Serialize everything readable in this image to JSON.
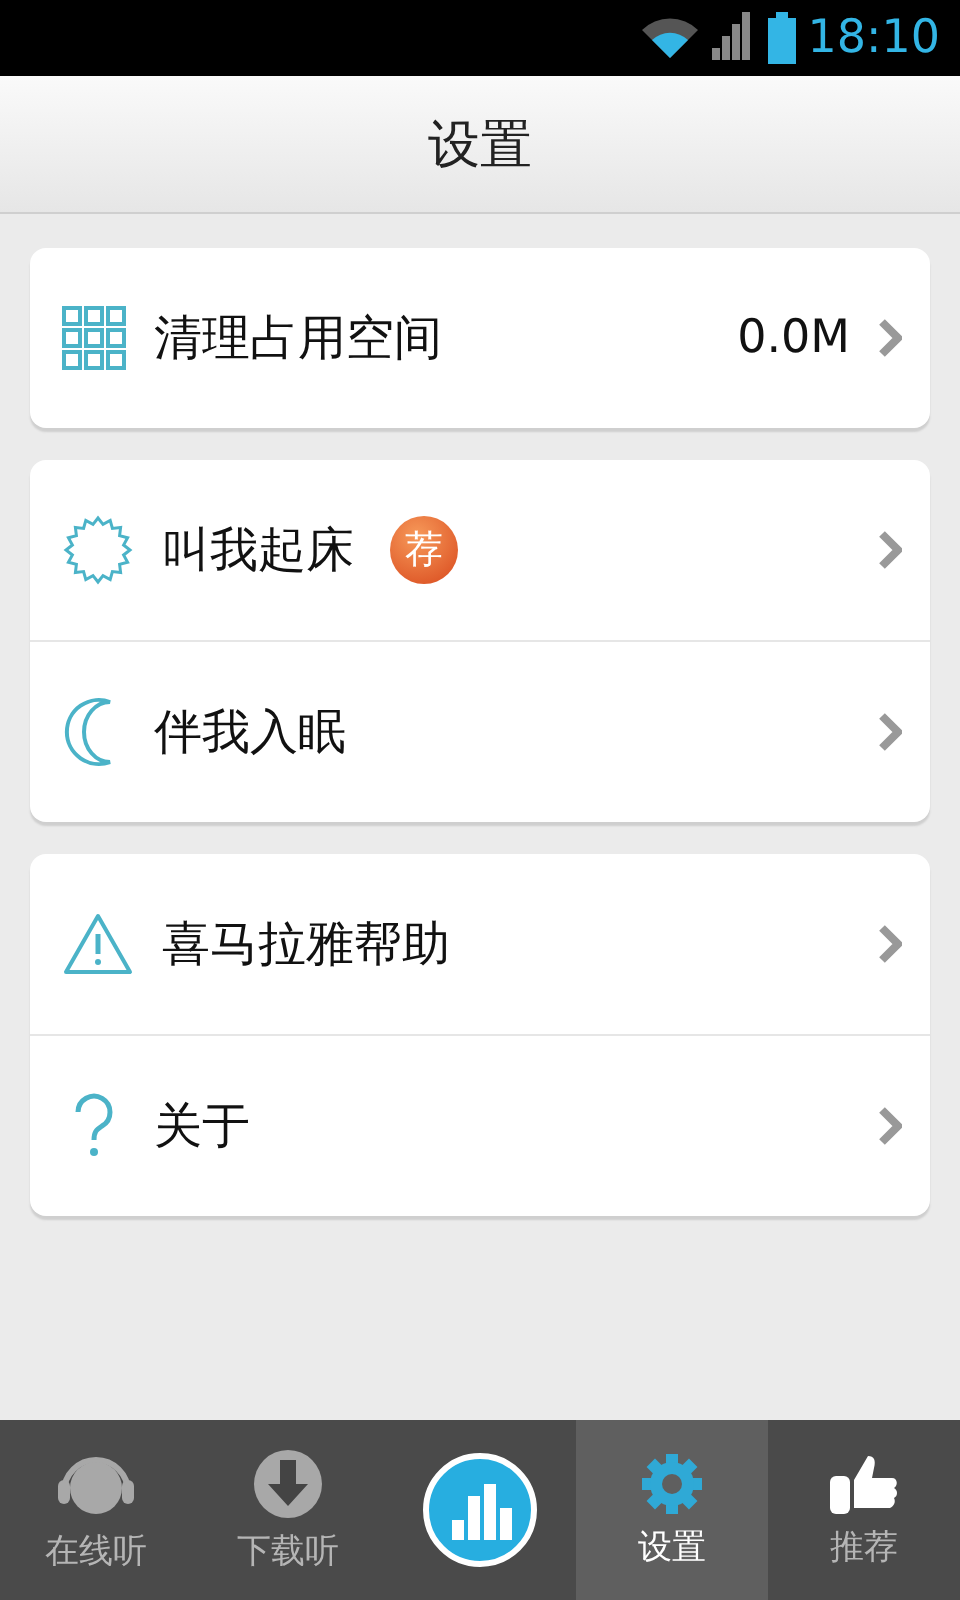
{
  "status_bar": {
    "time": "18:10"
  },
  "header": {
    "title": "设置"
  },
  "groups": [
    {
      "items": [
        {
          "label": "清理占用空间",
          "value": "0.0M"
        }
      ]
    },
    {
      "items": [
        {
          "label": "叫我起床",
          "badge": "荐"
        },
        {
          "label": "伴我入眠"
        }
      ]
    },
    {
      "items": [
        {
          "label": "喜马拉雅帮助"
        },
        {
          "label": "关于"
        }
      ]
    }
  ],
  "nav": [
    {
      "kind": "tab",
      "label": "在线听",
      "selected": false
    },
    {
      "kind": "tab",
      "label": "下载听",
      "selected": false
    },
    {
      "kind": "player"
    },
    {
      "kind": "tab",
      "label": "设置",
      "selected": true
    },
    {
      "kind": "tab",
      "label": "推荐",
      "selected": false
    }
  ]
}
